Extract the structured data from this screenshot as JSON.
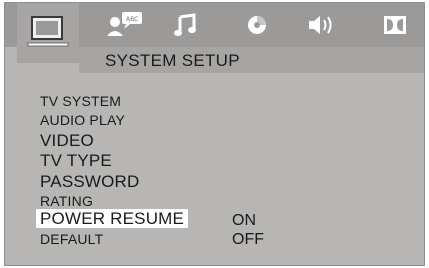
{
  "header": {
    "title": "SYSTEM SETUP"
  },
  "tabs": [
    {
      "name": "system-setup",
      "icon": "tv-icon",
      "active": true
    },
    {
      "name": "language",
      "icon": "user-speech-icon"
    },
    {
      "name": "audio",
      "icon": "music-note-icon"
    },
    {
      "name": "video",
      "icon": "color-palette-icon"
    },
    {
      "name": "speaker",
      "icon": "speaker-icon"
    },
    {
      "name": "digital",
      "icon": "dolby-icon"
    }
  ],
  "menu": {
    "items": [
      {
        "label": "TV SYSTEM"
      },
      {
        "label": "AUDIO PLAY"
      },
      {
        "label": "VIDEO"
      },
      {
        "label": "TV TYPE"
      },
      {
        "label": "PASSWORD"
      },
      {
        "label": "RATING"
      },
      {
        "label": "POWER RESUME",
        "selected": true
      },
      {
        "label": "DEFAULT"
      }
    ],
    "options": [
      "ON",
      "OFF"
    ]
  },
  "colors": {
    "panel": "#b7b6b4",
    "iconbar": "#9c9a98",
    "highlight": "#ffffff"
  }
}
